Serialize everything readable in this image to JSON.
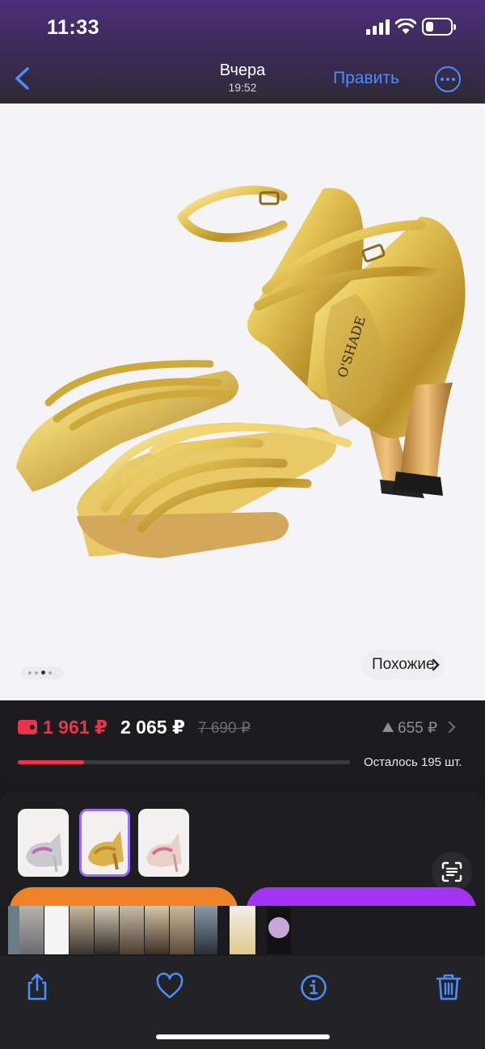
{
  "status_bar": {
    "time": "11:33"
  },
  "nav": {
    "title": "Вчера",
    "subtitle": "19:52",
    "edit_label": "Править"
  },
  "photo": {
    "brand_on_product": "O'SHADE",
    "similar_label": "Похожие",
    "page_dots": 4,
    "active_dot": 3
  },
  "price": {
    "wallet_price": "1 961 ₽",
    "price": "2 065 ₽",
    "old_price": "7 690 ₽",
    "price_change": "655 ₽",
    "stock_left": "Осталось 195 шт.",
    "stock_progress": 0.2
  },
  "colors": {
    "accent_red": "#e8344c",
    "accent_purple": "#9b6bff",
    "nav_blue": "#4a8dff",
    "orange": "#f0832a",
    "purple_btn": "#a234f2"
  },
  "thumbnails": [
    {
      "name": "silver-sandal",
      "selected": false
    },
    {
      "name": "gold-sandal",
      "selected": true
    },
    {
      "name": "rose-sandal",
      "selected": false
    }
  ],
  "toolbar": {
    "icons": [
      "share-icon",
      "heart-icon",
      "info-icon",
      "trash-icon"
    ]
  }
}
